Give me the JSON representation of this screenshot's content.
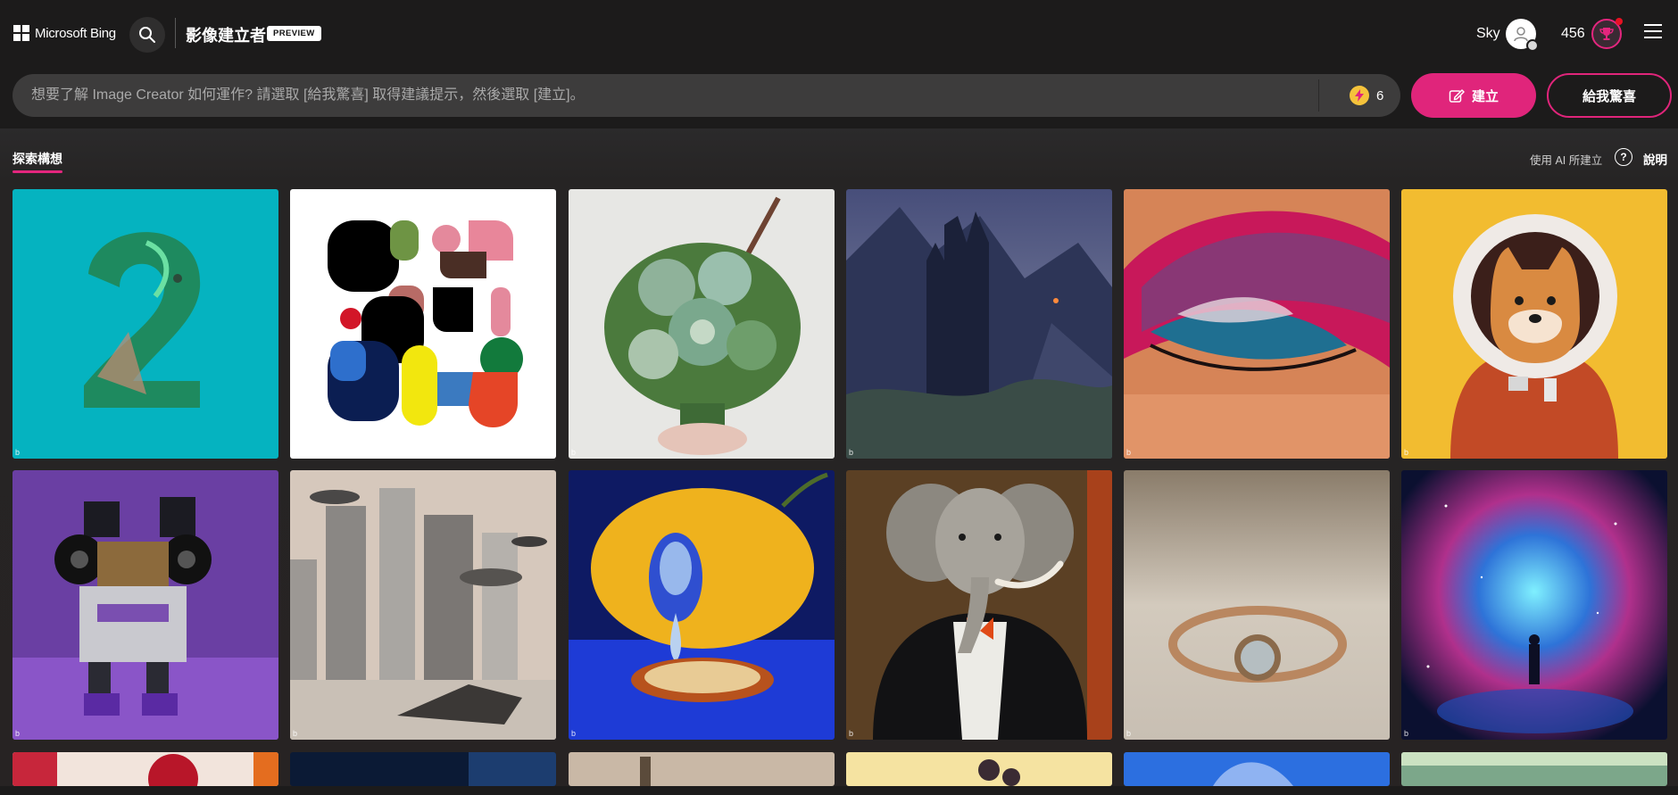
{
  "header": {
    "brand_text": "Microsoft Bing",
    "product_title": "影像建立者",
    "preview_badge": "PREVIEW",
    "user_name": "Sky",
    "points": "456",
    "icons": [
      "windows-logo-icon",
      "search-icon",
      "user-avatar-icon",
      "rewards-trophy-icon",
      "hamburger-menu-icon"
    ]
  },
  "prompt": {
    "placeholder": "想要了解 Image Creator 如何運作? 請選取 [給我驚喜] 取得建議提示，然後選取 [建立]。",
    "value": "",
    "boost_count": "6",
    "create_label": "建立",
    "surprise_label": "給我驚喜"
  },
  "explore": {
    "tab_label": "探索構想",
    "ai_note": "使用 AI 所建立",
    "help_label": "說明"
  },
  "colors": {
    "accent": "#e0257b",
    "background": "#1f1e1e",
    "prompt_box": "#3d3c3c"
  },
  "gallery": [
    {
      "name": "tile-number-two-chameleon"
    },
    {
      "name": "tile-abstract-shapes"
    },
    {
      "name": "tile-succulent-bouquet"
    },
    {
      "name": "tile-dark-castle-mountains"
    },
    {
      "name": "tile-colorful-eyeshadow"
    },
    {
      "name": "tile-shiba-astronaut"
    },
    {
      "name": "tile-purple-robot"
    },
    {
      "name": "tile-futuristic-city"
    },
    {
      "name": "tile-surreal-lemon"
    },
    {
      "name": "tile-elephant-tuxedo"
    },
    {
      "name": "tile-gold-ring"
    },
    {
      "name": "tile-cosmic-nebula-figure"
    },
    {
      "name": "tile-partial-red"
    },
    {
      "name": "tile-partial-dark-blue"
    },
    {
      "name": "tile-partial-sand"
    },
    {
      "name": "tile-partial-yellow"
    },
    {
      "name": "tile-partial-blue-flower"
    },
    {
      "name": "tile-partial-teal"
    }
  ]
}
